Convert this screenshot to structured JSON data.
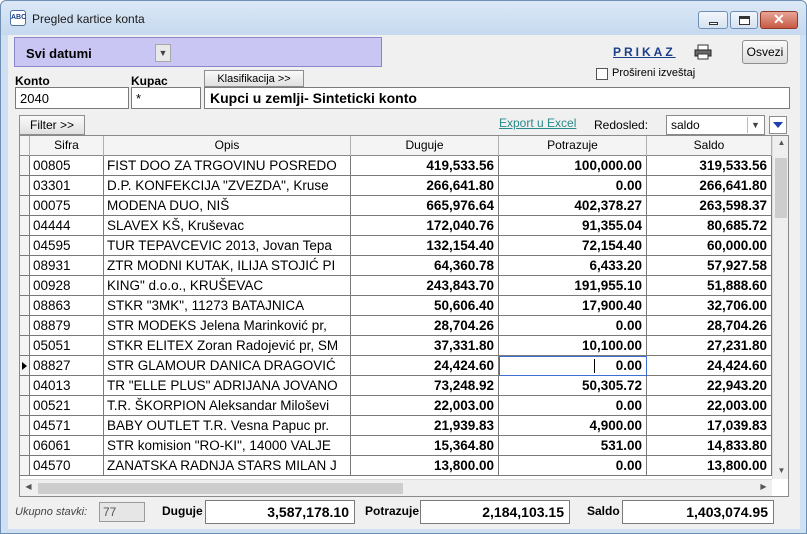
{
  "window": {
    "title": "Pregled kartice konta"
  },
  "toolbar": {
    "date_filter": "Svi datumi",
    "prikaz_label": "PRIKAZ",
    "osvezi_label": "Osvezi",
    "prosireni_label": "Prošireni izveštaj",
    "prosireni_checked": false
  },
  "fields": {
    "konto_label": "Konto",
    "konto_value": "2040",
    "kupac_label": "Kupac",
    "kupac_value": "*",
    "klasifikacija_label": "Klasifikacija >>",
    "description": "Kupci u zemlji- Sinteticki konto"
  },
  "controls": {
    "filter_label": "Filter >>",
    "export_label": "Export u Excel",
    "redosled_label": "Redosled:",
    "redosled_value": "saldo"
  },
  "grid": {
    "columns": [
      "Sifra",
      "Opis",
      "Duguje",
      "Potrazuje",
      "Saldo"
    ],
    "selected_row": 10,
    "rows": [
      [
        "00805",
        "FIST DOO ZA TRGOVINU POSREDO",
        "419,533.56",
        "100,000.00",
        "319,533.56"
      ],
      [
        "03301",
        "D.P. KONFEKCIJA \"ZVEZDA\", Kruse",
        "266,641.80",
        "0.00",
        "266,641.80"
      ],
      [
        "00075",
        "MODENA DUO, NIŠ",
        "665,976.64",
        "402,378.27",
        "263,598.37"
      ],
      [
        "04444",
        "SLAVEX KŠ, Kruševac",
        "172,040.76",
        "91,355.04",
        "80,685.72"
      ],
      [
        "04595",
        "TUR TEPAVCEVIC 2013, Jovan Tepa",
        "132,154.40",
        "72,154.40",
        "60,000.00"
      ],
      [
        "08931",
        "ZTR MODNI KUTAK, ILIJA STOJIĆ PI",
        "64,360.78",
        "6,433.20",
        "57,927.58"
      ],
      [
        "00928",
        "KING\" d.o.o., KRUŠEVAC",
        "243,843.70",
        "191,955.10",
        "51,888.60"
      ],
      [
        "08863",
        "STKR \"3MK\", 11273 BATAJNICA",
        "50,606.40",
        "17,900.40",
        "32,706.00"
      ],
      [
        "08879",
        "STR MODEKS Jelena Marinković pr,",
        "28,704.26",
        "0.00",
        "28,704.26"
      ],
      [
        "05051",
        "STKR ELITEX Zoran Radojević pr, SM",
        "37,331.80",
        "10,100.00",
        "27,231.80"
      ],
      [
        "08827",
        "STR GLAMOUR DANICA DRAGOVIĆ",
        "24,424.60",
        "0.00",
        "24,424.60"
      ],
      [
        "04013",
        "TR \"ELLE PLUS\" ADRIJANA JOVANO",
        "73,248.92",
        "50,305.72",
        "22,943.20"
      ],
      [
        "00521",
        "T.R. ŠKORPION Aleksandar Miloševi",
        "22,003.00",
        "0.00",
        "22,003.00"
      ],
      [
        "04571",
        "BABY OUTLET T.R. Vesna Papuc pr.",
        "21,939.83",
        "4,900.00",
        "17,039.83"
      ],
      [
        "06061",
        "STR komision \"RO-KI\", 14000 VALJE",
        "15,364.80",
        "531.00",
        "14,833.80"
      ],
      [
        "04570",
        "ZANATSKA RADNJA STARS MILAN J",
        "13,800.00",
        "0.00",
        "13,800.00"
      ]
    ]
  },
  "footer": {
    "ukupno_label": "Ukupno stavki:",
    "ukupno_value": "77",
    "duguje_label": "Duguje",
    "duguje_total": "3,587,178.10",
    "potrazuje_label": "Potrazuje",
    "potrazuje_total": "2,184,103.15",
    "saldo_label": "Saldo",
    "saldo_total": "1,403,074.95"
  }
}
